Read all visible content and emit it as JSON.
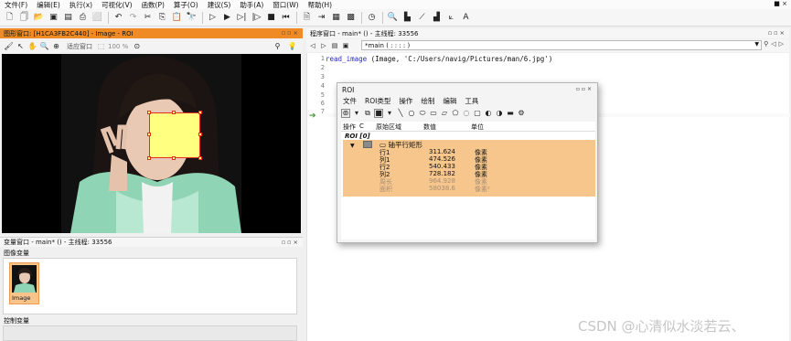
{
  "menubar": {
    "items": [
      "文件(F)",
      "编辑(E)",
      "执行(x)",
      "可视化(V)",
      "函数(P)",
      "算子(O)",
      "建议(S)",
      "助手(A)",
      "窗口(W)",
      "帮助(H)"
    ],
    "window_controls": "■ ×"
  },
  "graphics_window": {
    "title": "图形窗口: [H1CA3FB2C440] - Image - ROI",
    "fit_label": "适应窗口",
    "zoom_label": "100 %"
  },
  "variable_window": {
    "title": "变量窗口 - main* () - 主线程: 33556",
    "image_vars_label": "图像变量",
    "thumbnail_label": "Image",
    "control_vars_label": "控制变量"
  },
  "program_window": {
    "title": "程序窗口 - main* () - 主线程: 33556",
    "procedure_select": "*main ( : : : : )",
    "line_numbers": [
      "1",
      "2",
      "3",
      "4",
      "5",
      "6",
      "7"
    ],
    "code_operator": "read_image",
    "code_args": " (Image, 'C:/Users/navig/Pictures/man/6.jpg')"
  },
  "roi_dialog": {
    "title": "ROI",
    "menu": [
      "文件",
      "ROI类型",
      "操作",
      "绘制",
      "编辑",
      "工具"
    ],
    "columns": [
      "操作",
      "C",
      "原始区域",
      "数值",
      "单位"
    ],
    "root_label": "ROI [0]",
    "shape_label": "轴平行矩形",
    "params": [
      {
        "name": "行1",
        "value": "311.624",
        "unit": "像素"
      },
      {
        "name": "列1",
        "value": "474.526",
        "unit": "像素"
      },
      {
        "name": "行2",
        "value": "540.433",
        "unit": "像素"
      },
      {
        "name": "列2",
        "value": "728.182",
        "unit": "像素"
      },
      {
        "name": "周长",
        "value": "964.928",
        "unit": "像素"
      },
      {
        "name": "面积",
        "value": "58038.6",
        "unit": "像素²"
      }
    ]
  },
  "watermark": "CSDN @心清似水淡若云、",
  "colors": {
    "graphics_title_bg": "#f08a24",
    "roi_fill": "#ffff80",
    "roi_outline": "#e03020",
    "roi_list_highlight": "#f7c68c"
  }
}
